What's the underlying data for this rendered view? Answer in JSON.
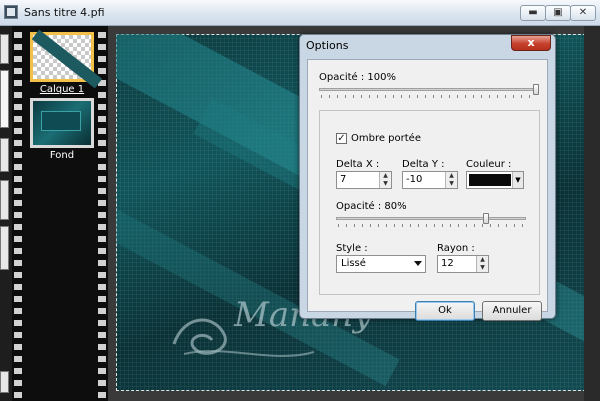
{
  "window": {
    "title": "Sans titre 4.pfi",
    "min_icon": "minimize-icon",
    "restore_icon": "restore-icon",
    "close_icon": "close-icon"
  },
  "layers": [
    {
      "label": "Calque 1",
      "selected": true
    },
    {
      "label": "Fond",
      "selected": false
    }
  ],
  "canvas": {
    "watermark_text": "Manany",
    "accent": "#1b6e75"
  },
  "dialog": {
    "title": "Options",
    "close_label": "x",
    "opacity_label": "Opacité : 100%",
    "opacity_value": 1.0,
    "shadow": {
      "checkbox_label": "Ombre portée",
      "checked": true,
      "delta_x_label": "Delta X :",
      "delta_x_value": "7",
      "delta_y_label": "Delta Y :",
      "delta_y_value": "-10",
      "color_label": "Couleur :",
      "color_value": "#0a0a0a",
      "opacity_label": "Opacité : 80%",
      "opacity_value": 0.8,
      "style_label": "Style :",
      "style_value": "Lissé",
      "radius_label": "Rayon :",
      "radius_value": "12"
    },
    "ok_label": "Ok",
    "cancel_label": "Annuler"
  }
}
